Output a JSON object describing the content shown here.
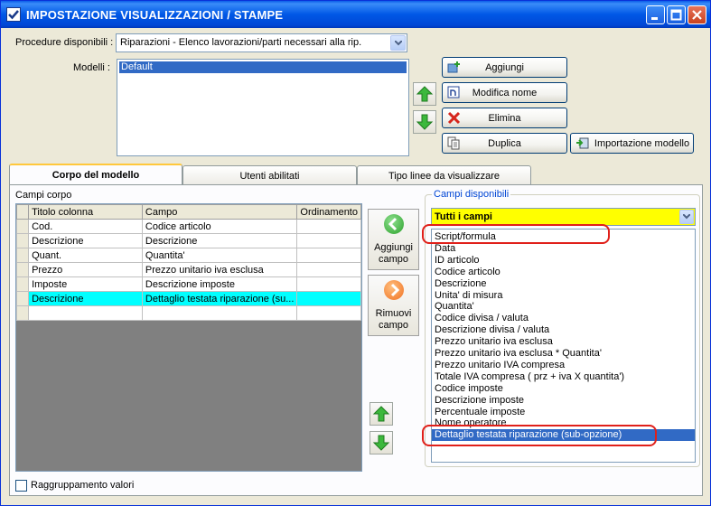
{
  "window": {
    "title": "IMPOSTAZIONE VISUALIZZAZIONI / STAMPE"
  },
  "procedure": {
    "label": "Procedure disponibili :",
    "value": "Riparazioni - Elenco lavorazioni/parti necessari alla rip."
  },
  "modelli": {
    "label": "Modelli :",
    "items": [
      "Default"
    ]
  },
  "buttons": {
    "aggiungi": "Aggiungi",
    "modifica_nome": "Modifica nome",
    "elimina": "Elimina",
    "duplica": "Duplica",
    "importazione": "Importazione modello"
  },
  "tabs": [
    {
      "label": "Corpo del modello",
      "active": true
    },
    {
      "label": "Utenti abilitati",
      "active": false
    },
    {
      "label": "Tipo linee da visualizzare",
      "active": false
    }
  ],
  "corpo": {
    "label": "Campi corpo",
    "columns": [
      "Titolo colonna",
      "Campo",
      "Ordinamento"
    ],
    "rows": [
      {
        "titolo": "Cod.",
        "campo": "Codice articolo",
        "ord": ""
      },
      {
        "titolo": "Descrizione",
        "campo": "Descrizione",
        "ord": ""
      },
      {
        "titolo": "Quant.",
        "campo": "Quantita'",
        "ord": ""
      },
      {
        "titolo": "Prezzo",
        "campo": "Prezzo unitario iva esclusa",
        "ord": ""
      },
      {
        "titolo": "Imposte",
        "campo": "Descrizione imposte",
        "ord": ""
      },
      {
        "titolo": "Descrizione",
        "campo": "Dettaglio testata riparazione (su...",
        "ord": ""
      },
      {
        "titolo": "",
        "campo": "",
        "ord": ""
      }
    ],
    "selected_row": 5
  },
  "side": {
    "aggiungi_campo": "Aggiungi campo",
    "rimuovi_campo": "Rimuovi campo"
  },
  "disponibili": {
    "title": "Campi disponibili",
    "filter": "Tutti i campi",
    "items": [
      "Script/formula",
      "Data",
      "ID articolo",
      "Codice articolo",
      "Descrizione",
      "Unita' di misura",
      "Quantita'",
      "Codice divisa / valuta",
      "Descrizione divisa / valuta",
      "Prezzo unitario iva esclusa",
      "Prezzo unitario iva esclusa * Quantita'",
      "Prezzo unitario IVA compresa",
      "Totale IVA compresa ( prz + iva X quantita')",
      "Codice imposte",
      "Descrizione imposte",
      "Percentuale imposte",
      "Nome operatore",
      "Dettaglio testata riparazione (sub-opzione)"
    ],
    "selected_index": 17
  },
  "raggruppamento": {
    "label": "Raggruppamento valori",
    "checked": false
  },
  "colors": {
    "title_blue": "#0054e3",
    "selected_row": "#00ffff",
    "list_selection": "#316ac5",
    "highlight_red": "#e0201a",
    "filter_yellow": "#ffff00"
  }
}
